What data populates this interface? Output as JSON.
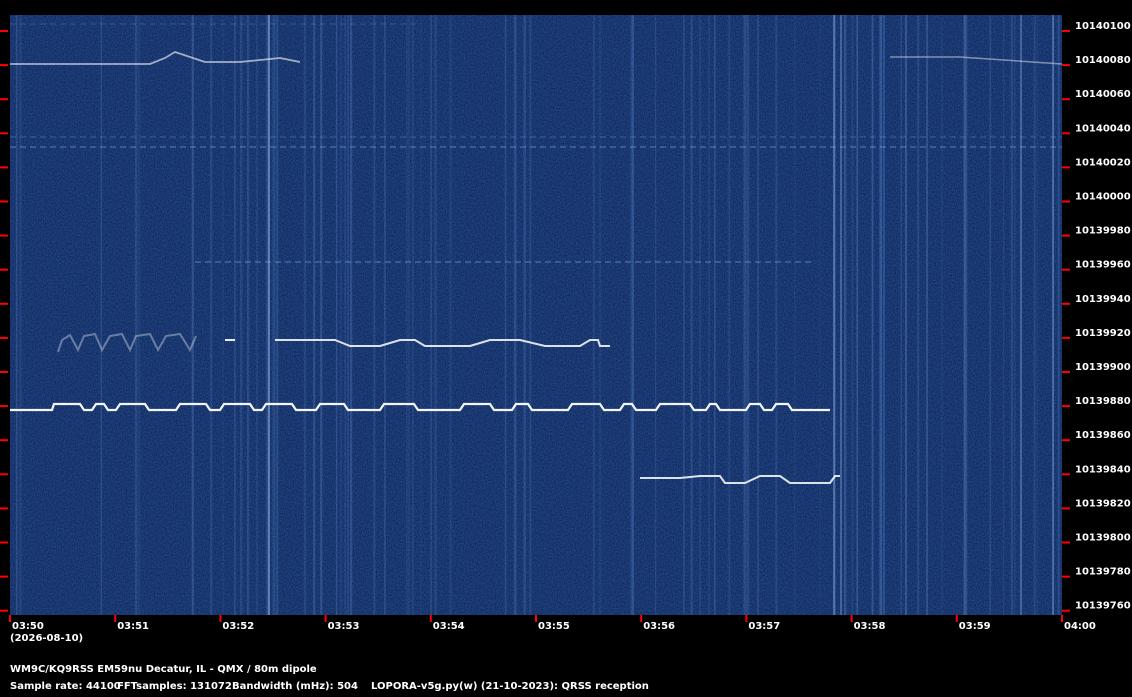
{
  "waterfall": {
    "background_color": "#0a2258",
    "signal_color": "#ffffff",
    "tick_color": "#ff0000",
    "freq_labels": [
      "10140100",
      "10140080",
      "10140060",
      "10140040",
      "10140020",
      "10140000",
      "10139980",
      "10139960",
      "10139940",
      "10139920",
      "10139900",
      "10139880",
      "10139860",
      "10139840",
      "10139820",
      "10139800",
      "10139780",
      "10139760"
    ],
    "time_labels": [
      "03:50",
      "03:51",
      "03:52",
      "03:53",
      "03:54",
      "03:55",
      "03:56",
      "03:57",
      "03:58",
      "03:59",
      "04:00"
    ],
    "date_label": "(2026-08-10)"
  },
  "info": {
    "station": "WM9C/KQ9RSS EM59nu Decatur, IL - QMX / 80m dipole",
    "sample_rate": "Sample rate: 44100",
    "fft_samples": "FFTsamples: 131072",
    "bandwidth": "Bandwidth (mHz): 504",
    "software": "LOPORA-v5g.py(w) (21-10-2023): QRSS reception"
  }
}
